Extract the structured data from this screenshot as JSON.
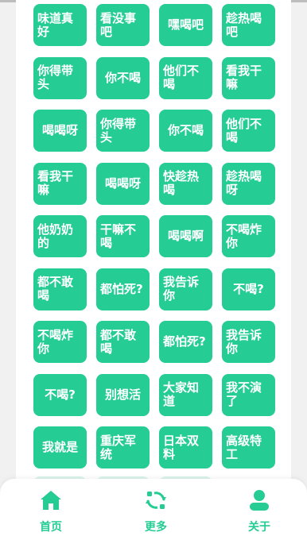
{
  "tiles": [
    "味道真好",
    "看没事吧",
    "嘿喝吧",
    "趁热喝吧",
    "你得带头",
    "你不喝",
    "他们不喝",
    "看我干嘛",
    "喝喝呀",
    "你得带头",
    "你不喝",
    "他们不喝",
    "看我干嘛",
    "喝喝呀",
    "快趁热喝",
    "趁热喝呀",
    "他奶奶的",
    "干嘛不喝",
    "喝喝啊",
    "不喝炸你",
    "都不敢喝",
    "都怕死?",
    "我告诉你",
    "不喝?",
    "不喝炸你",
    "都不敢喝",
    "都怕死?",
    "我告诉你",
    "不喝?",
    "别想活",
    "大家知道",
    "我不演了",
    "我就是",
    "重庆军统",
    "日本双料",
    "高级特工"
  ],
  "tabbar": {
    "home": {
      "label": "首页",
      "icon": "home-icon"
    },
    "more": {
      "label": "更多",
      "icon": "refresh-icon"
    },
    "about": {
      "label": "关于",
      "icon": "user-icon"
    }
  },
  "colors": {
    "accent": "#25cc94",
    "background": "#f1f1f1",
    "card": "#ffffff"
  }
}
